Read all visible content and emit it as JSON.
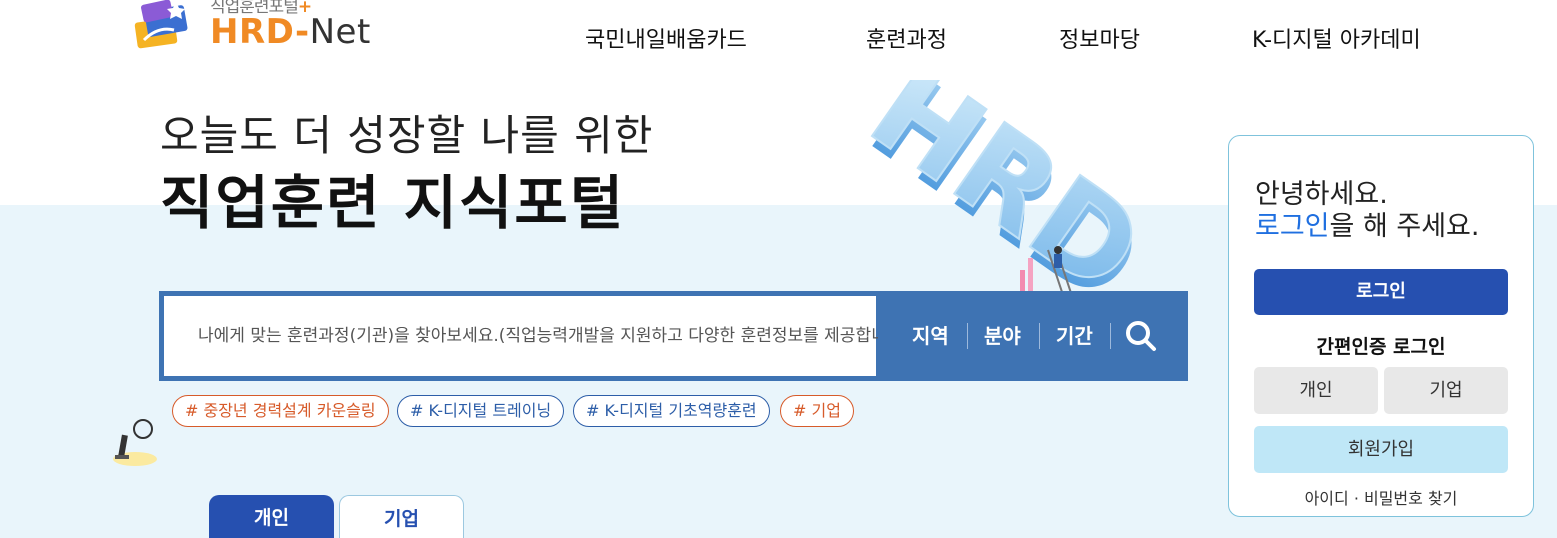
{
  "header": {
    "logo_sub": "직업훈련포털",
    "logo_plus": "+",
    "logo_hrd": "HRD",
    "logo_dash": "-",
    "logo_net": "Net",
    "nav": [
      "국민내일배움카드",
      "훈련과정",
      "정보마당",
      "K-디지털 아카데미"
    ]
  },
  "hero": {
    "subtitle": "오늘도 더 성장할 나를 위한",
    "title": "직업훈련 지식포털",
    "illustration_text": "HRD"
  },
  "search": {
    "placeholder": "나에게 맞는 훈련과정(기관)을 찾아보세요.(직업능력개발을 지원하고 다양한 훈련정보를 제공합니다.)",
    "filters": [
      "지역",
      "분야",
      "기간"
    ],
    "button_icon": "search-icon"
  },
  "tags": [
    {
      "label": "# 중장년 경력설계 카운슬링",
      "color": "#d75b2a"
    },
    {
      "label": "# K-디지털 트레이닝",
      "color": "#2d5ea8"
    },
    {
      "label": "# K-디지털 기초역량훈련",
      "color": "#2d5ea8"
    },
    {
      "label": "# 기업",
      "color": "#d75b2a"
    }
  ],
  "tabs": {
    "personal": "개인",
    "company": "기업"
  },
  "login": {
    "greeting_line1": "안녕하세요.",
    "greeting_highlight": "로그인",
    "greeting_rest": "을 해 주세요.",
    "login_button": "로그인",
    "easy_login_title": "간편인증 로그인",
    "personal_button": "개인",
    "company_button": "기업",
    "join_button": "회원가입",
    "find_link": "아이디 · 비밀번호 찾기"
  },
  "colors": {
    "primary": "#2650b0",
    "search_bar": "#3e73b3",
    "accent_orange": "#f08a24",
    "hero_bg": "#e9f5fb",
    "join_bg": "#bfe7f7"
  }
}
